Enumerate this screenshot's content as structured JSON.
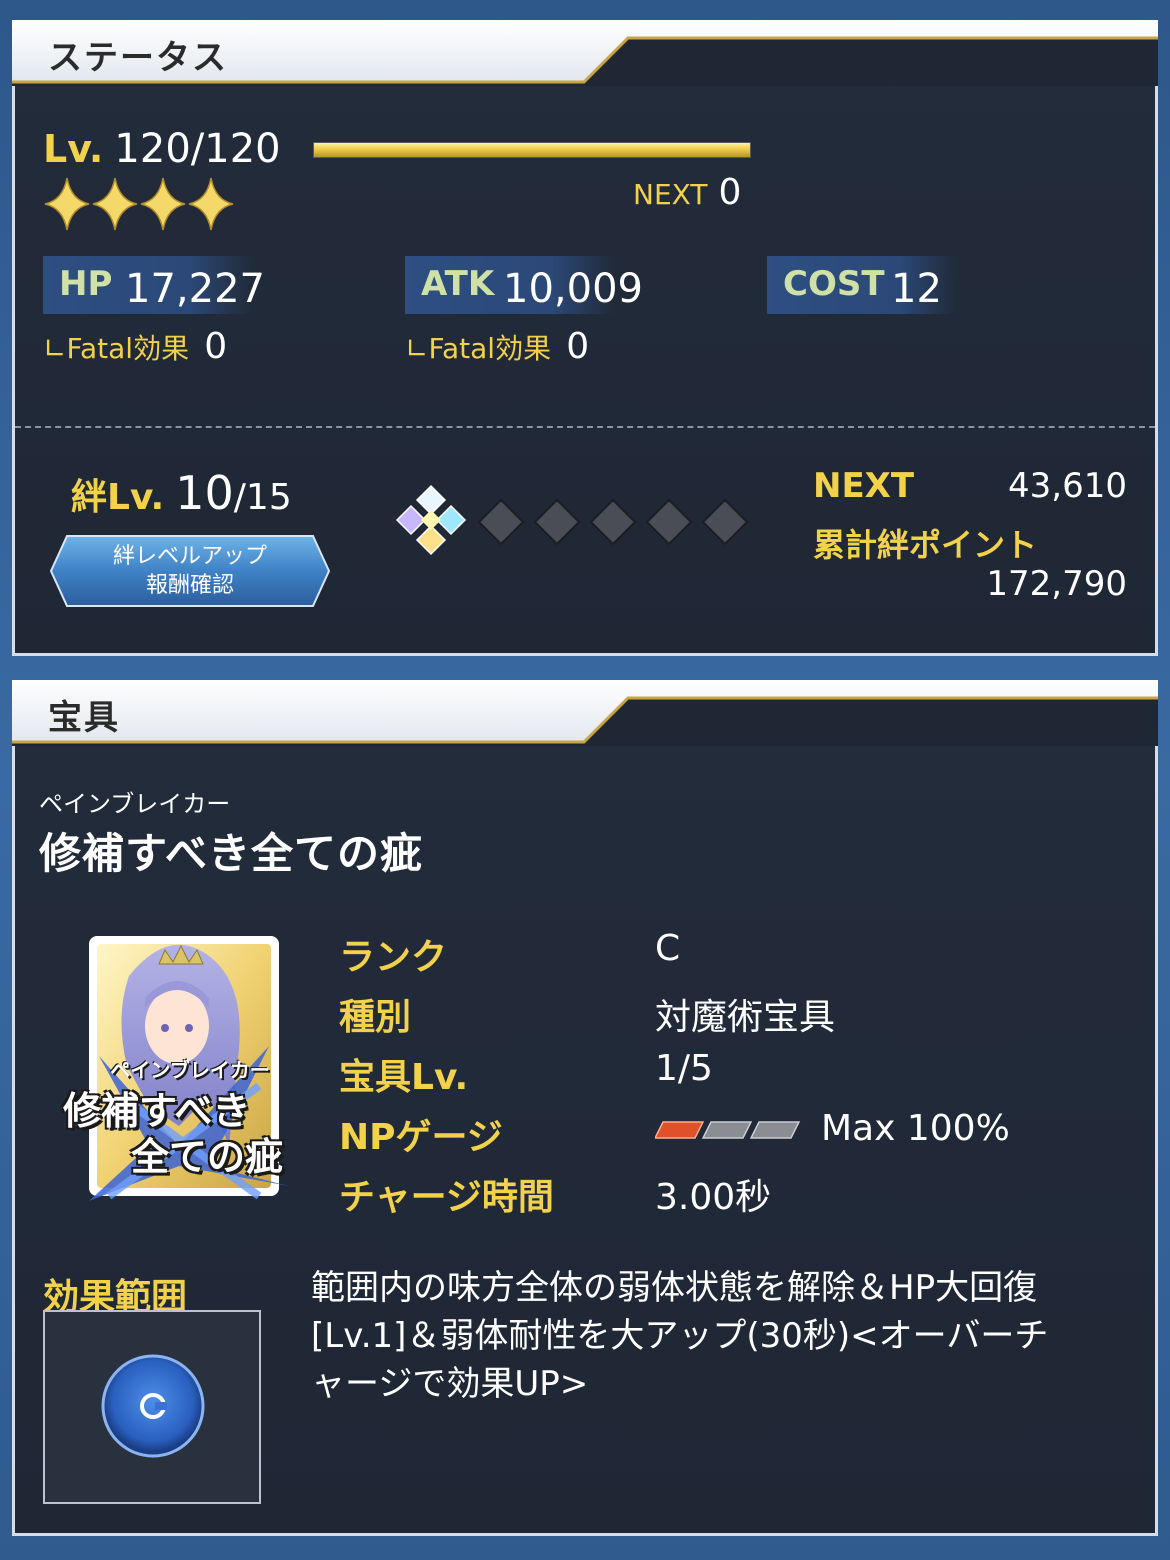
{
  "status": {
    "title": "ステータス",
    "level_label": "Lv.",
    "level_value": "120/120",
    "level_progress": 1.0,
    "stars": 4,
    "next_label": "NEXT",
    "next_value": "0",
    "hp_label": "HP",
    "hp_value": "17,227",
    "atk_label": "ATK",
    "atk_value": "10,009",
    "cost_label": "COST",
    "cost_value": "12",
    "fatal_label": "Fatal効果",
    "hp_fatal_value": "0",
    "atk_fatal_value": "0",
    "bond_label": "絆Lv.",
    "bond_value": "10",
    "bond_max": "/15",
    "bond_button_line1": "絆レベルアップ",
    "bond_button_line2": "報酬確認",
    "bond_next_label": "NEXT",
    "bond_next_value": "43,610",
    "bond_total_label": "累計絆ポイント",
    "bond_total_value": "172,790"
  },
  "np": {
    "title": "宝具",
    "ruby": "ペインブレイカー",
    "name": "修補すべき全ての疵",
    "card_ruby": "ペインブレイカー",
    "card_line1": "修補すべき",
    "card_line2": "全ての疵",
    "rows": [
      {
        "label": "ランク",
        "value": "C"
      },
      {
        "label": "種別",
        "value": "対魔術宝具"
      },
      {
        "label": "宝具Lv.",
        "value": "1/5"
      },
      {
        "label": "NPゲージ",
        "value": "Max 100%"
      },
      {
        "label": "チャージ時間",
        "value": "3.00秒"
      }
    ],
    "np_gauge_filled": 1,
    "np_gauge_total": 3,
    "range_label": "効果範囲",
    "description_line1": "範囲内の味方全体の弱体状態を解除＆HP大回復",
    "description_line2": "[Lv.1]＆弱体耐性を大アップ(30秒)<オーバーチ",
    "description_line3": "ャージで効果UP>"
  },
  "colors": {
    "gold": "#f2d24a",
    "panel_bg": "#1f2735",
    "stat_label": "#cfe1a6",
    "page_bg": "#2f5b8e"
  }
}
